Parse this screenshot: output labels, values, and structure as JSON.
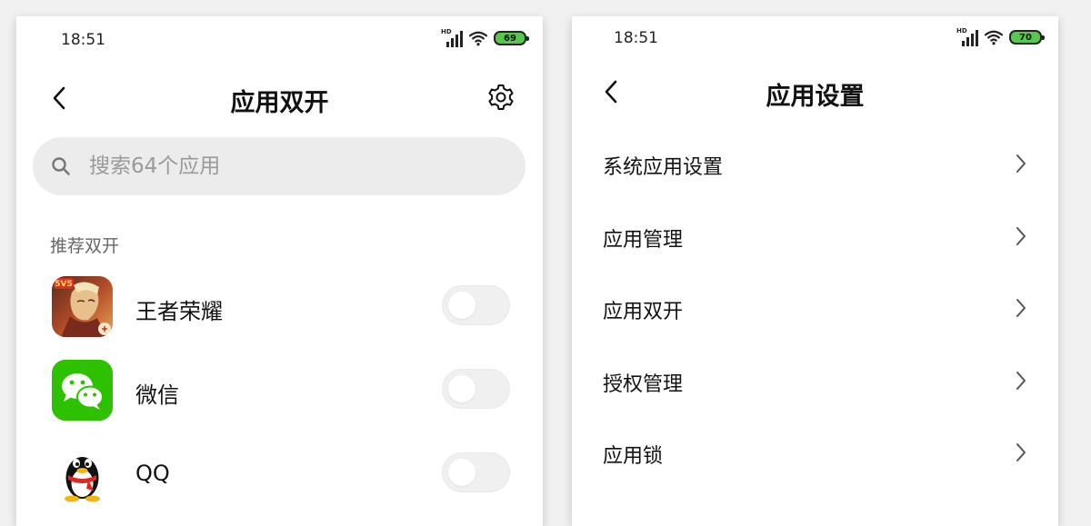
{
  "left_screen": {
    "status_bar": {
      "time": "18:51",
      "battery": "69",
      "battery_color": "#57c84d"
    },
    "header": {
      "title": "应用双开"
    },
    "search": {
      "placeholder": "搜索64个应用"
    },
    "section_label": "推荐双开",
    "apps": [
      {
        "name": "王者荣耀",
        "icon": "honor-of-kings-icon",
        "enabled": false
      },
      {
        "name": "微信",
        "icon": "wechat-icon",
        "enabled": false
      },
      {
        "name": "QQ",
        "icon": "qq-penguin-icon",
        "enabled": false
      }
    ]
  },
  "right_screen": {
    "status_bar": {
      "time": "18:51",
      "battery": "70",
      "battery_color": "#57c84d"
    },
    "header": {
      "title": "应用设置"
    },
    "items": [
      {
        "label": "系统应用设置"
      },
      {
        "label": "应用管理"
      },
      {
        "label": "应用双开"
      },
      {
        "label": "授权管理"
      },
      {
        "label": "应用锁"
      }
    ]
  },
  "colors": {
    "wechat_green": "#2dc100",
    "toggle_off": "#f0f0f0",
    "search_bg": "#ececec"
  }
}
